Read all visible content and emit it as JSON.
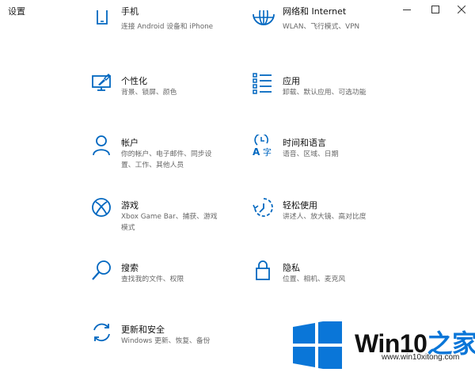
{
  "window": {
    "title": "设置",
    "minimize_icon": "minimize-icon",
    "maximize_icon": "maximize-icon",
    "close_icon": "close-icon"
  },
  "accent_color": "#0067c0",
  "categories": [
    {
      "id": "phone",
      "title": "手机",
      "desc": "连接 Android 设备和 iPhone",
      "icon": "phone-icon"
    },
    {
      "id": "network",
      "title": "网络和 Internet",
      "desc": "WLAN、飞行模式、VPN",
      "icon": "globe-icon"
    },
    {
      "id": "personalization",
      "title": "个性化",
      "desc": "背景、锁屏、颜色",
      "icon": "paint-brush-icon"
    },
    {
      "id": "apps",
      "title": "应用",
      "desc": "卸载、默认应用、可选功能",
      "icon": "apps-list-icon"
    },
    {
      "id": "accounts",
      "title": "帐户",
      "desc": "你的帐户、电子邮件、同步设置、工作、其他人员",
      "icon": "person-icon"
    },
    {
      "id": "time-language",
      "title": "时间和语言",
      "desc": "语音、区域、日期",
      "icon": "time-language-icon"
    },
    {
      "id": "gaming",
      "title": "游戏",
      "desc": "Xbox Game Bar、捕获、游戏模式",
      "icon": "xbox-icon"
    },
    {
      "id": "ease-of-access",
      "title": "轻松使用",
      "desc": "讲述人、放大镜、高对比度",
      "icon": "ease-of-access-icon"
    },
    {
      "id": "search",
      "title": "搜索",
      "desc": "查找我的文件、权限",
      "icon": "search-icon"
    },
    {
      "id": "privacy",
      "title": "隐私",
      "desc": "位置、相机、麦克风",
      "icon": "lock-icon"
    },
    {
      "id": "update-security",
      "title": "更新和安全",
      "desc": "Windows 更新、恢复、备份",
      "icon": "sync-icon"
    }
  ],
  "watermark": {
    "brand": "Win10",
    "brand_suffix": "之家",
    "url": "www.win10xitong.com",
    "colors": [
      "#0a76d8",
      "#111111"
    ]
  }
}
